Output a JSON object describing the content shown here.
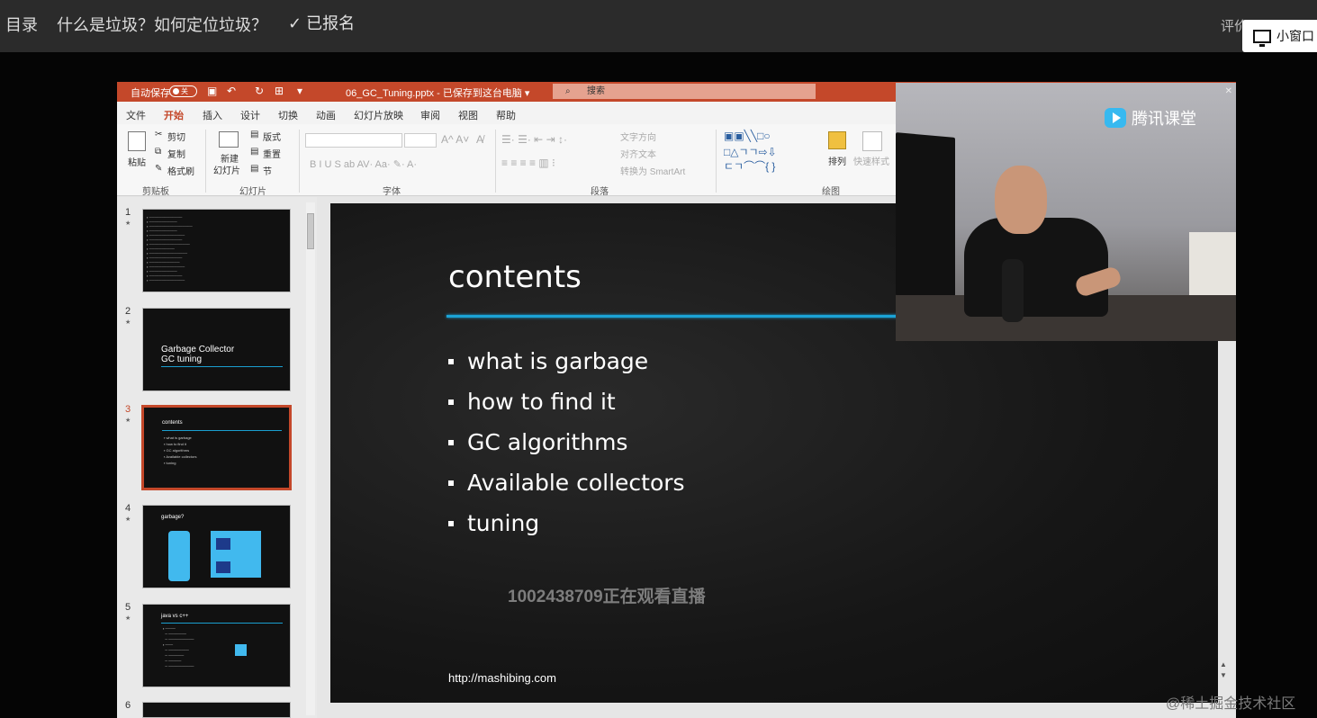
{
  "topbar": {
    "catalog": "目录",
    "lesson_title": "什么是垃圾？如何定位垃圾？",
    "registered": "已报名",
    "rate": "评价",
    "small_window": "小窗口"
  },
  "ppt": {
    "autosave": "自动保存",
    "autosave_state": "关",
    "file_name": "06_GC_Tuning.pptx  -  已保存到这台电脑 ▾",
    "search_placeholder": "搜索",
    "menu": [
      "文件",
      "开始",
      "插入",
      "设计",
      "切换",
      "动画",
      "幻灯片放映",
      "审阅",
      "视图",
      "帮助"
    ],
    "ribbon": {
      "clipboard": {
        "paste": "粘贴",
        "cut": "剪切",
        "copy": "复制",
        "format_painter": "格式刷",
        "group": "剪贴板"
      },
      "slides": {
        "new_slide": "新建",
        "new_slide2": "幻灯片",
        "layout": "版式",
        "reset": "重置",
        "section": "节",
        "group": "幻灯片"
      },
      "font": {
        "group": "字体"
      },
      "paragraph": {
        "text_direction": "文字方向",
        "align_text": "对齐文本",
        "smartart": "转换为 SmartArt",
        "group": "段落"
      },
      "drawing": {
        "arrange": "排列",
        "quick_styles": "快速样式",
        "group": "绘图"
      }
    },
    "thumbnails": [
      {
        "num": "1",
        "title": ""
      },
      {
        "num": "2",
        "title": "Garbage Collector",
        "subtitle": "GC tuning"
      },
      {
        "num": "3",
        "title": "contents",
        "items": [
          "what is garbage",
          "how to find it",
          "GC algorithms",
          "Available collectors",
          "tuning"
        ]
      },
      {
        "num": "4",
        "title": "garbage?"
      },
      {
        "num": "5",
        "title": "java vs c++"
      },
      {
        "num": "6",
        "title": ""
      }
    ],
    "slide": {
      "title": "contents",
      "bullets": [
        "what is garbage",
        "how to find it",
        "GC algorithms",
        "Available collectors",
        "tuning"
      ],
      "url": "http://mashibing.com"
    }
  },
  "overlay": {
    "watching": "1002438709正在观看直播",
    "camera_logo": "腾讯课堂",
    "watermark": "@稀土掘金技术社区"
  },
  "colors": {
    "accent": "#c4482a",
    "slide_line": "#1ba3d6",
    "slide_bg": "#1b1b1b"
  }
}
